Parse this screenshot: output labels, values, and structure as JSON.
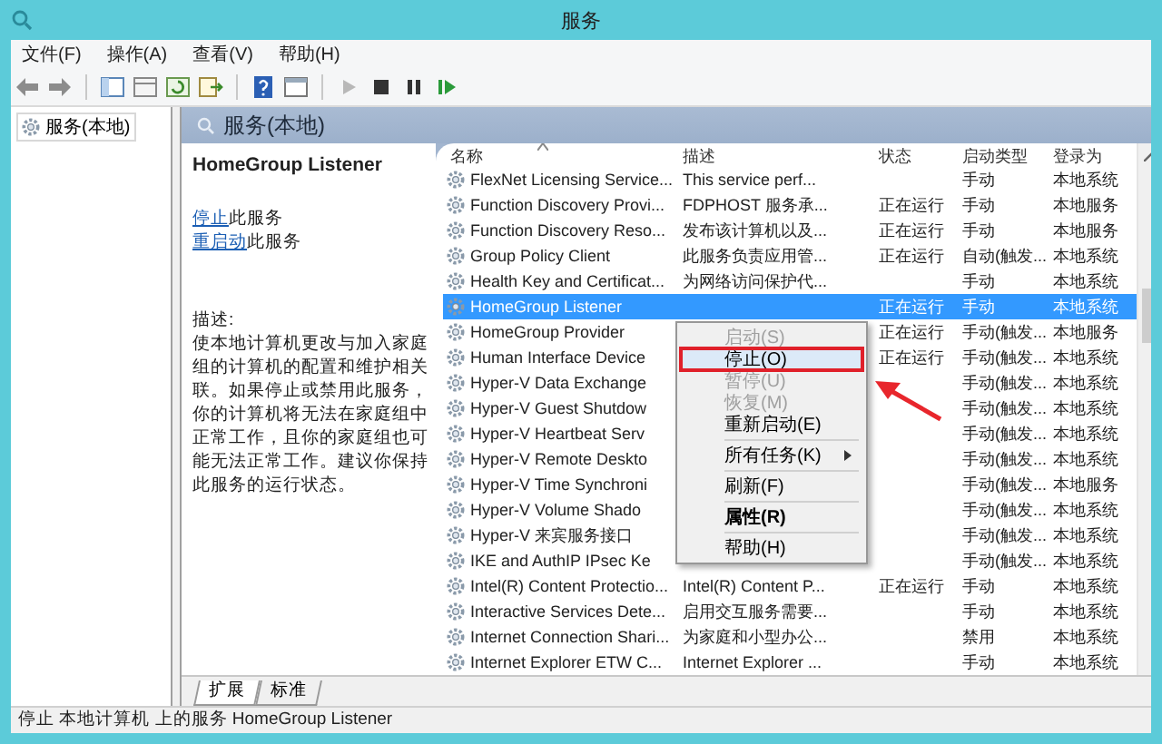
{
  "window": {
    "title": "服务"
  },
  "menu_bar": [
    "文件(F)",
    "操作(A)",
    "查看(V)",
    "帮助(H)"
  ],
  "tree": {
    "items": [
      {
        "label": "服务(本地)"
      }
    ]
  },
  "panel": {
    "title": "服务(本地)"
  },
  "details": {
    "service_name": "HomeGroup Listener",
    "actions": [
      {
        "link": "停止",
        "text": "此服务"
      },
      {
        "link": "重启动",
        "text": "此服务"
      }
    ],
    "description_label": "描述:",
    "description": "使本地计算机更改与加入家庭组的计算机的配置和维护相关联。如果停止或禁用此服务，你的计算机将无法在家庭组中正常工作，且你的家庭组也可能无法正常工作。建议你保持此服务的运行状态。"
  },
  "table": {
    "columns": [
      {
        "label": "名称",
        "sorted": true
      },
      {
        "label": "描述",
        "sorted": false
      },
      {
        "label": "状态",
        "sorted": false
      },
      {
        "label": "启动类型",
        "sorted": false
      },
      {
        "label": "登录为",
        "sorted": false
      }
    ],
    "rows": [
      {
        "name": "FlexNet Licensing Service...",
        "description": "This service perf...",
        "status": "",
        "startup": "手动",
        "logon": "本地系统",
        "selected": false
      },
      {
        "name": "Function Discovery Provi...",
        "description": "FDPHOST 服务承...",
        "status": "正在运行",
        "startup": "手动",
        "logon": "本地服务",
        "selected": false
      },
      {
        "name": "Function Discovery Reso...",
        "description": "发布该计算机以及...",
        "status": "正在运行",
        "startup": "手动",
        "logon": "本地服务",
        "selected": false
      },
      {
        "name": "Group Policy Client",
        "description": "此服务负责应用管...",
        "status": "正在运行",
        "startup": "自动(触发...",
        "logon": "本地系统",
        "selected": false
      },
      {
        "name": "Health Key and Certificat...",
        "description": "为网络访问保护代...",
        "status": "",
        "startup": "手动",
        "logon": "本地系统",
        "selected": false
      },
      {
        "name": "HomeGroup Listener",
        "description": "",
        "status": "正在运行",
        "startup": "手动",
        "logon": "本地系统",
        "selected": true
      },
      {
        "name": "HomeGroup Provider",
        "description": "",
        "status": "正在运行",
        "startup": "手动(触发...",
        "logon": "本地服务",
        "selected": false
      },
      {
        "name": "Human Interface Device",
        "description": "",
        "status": "正在运行",
        "startup": "手动(触发...",
        "logon": "本地系统",
        "selected": false
      },
      {
        "name": "Hyper-V Data Exchange",
        "description": "",
        "status": "",
        "startup": "手动(触发...",
        "logon": "本地系统",
        "selected": false
      },
      {
        "name": "Hyper-V Guest Shutdow",
        "description": "",
        "status": "",
        "startup": "手动(触发...",
        "logon": "本地系统",
        "selected": false
      },
      {
        "name": "Hyper-V Heartbeat Serv",
        "description": "",
        "status": "",
        "startup": "手动(触发...",
        "logon": "本地系统",
        "selected": false
      },
      {
        "name": "Hyper-V Remote Deskto",
        "description": "",
        "status": "",
        "startup": "手动(触发...",
        "logon": "本地系统",
        "selected": false
      },
      {
        "name": "Hyper-V Time Synchroni",
        "description": "",
        "status": "",
        "startup": "手动(触发...",
        "logon": "本地服务",
        "selected": false
      },
      {
        "name": "Hyper-V Volume Shado",
        "description": "",
        "status": "",
        "startup": "手动(触发...",
        "logon": "本地系统",
        "selected": false
      },
      {
        "name": "Hyper-V 来宾服务接口",
        "description": "",
        "status": "",
        "startup": "手动(触发...",
        "logon": "本地系统",
        "selected": false
      },
      {
        "name": "IKE and AuthIP IPsec Ke",
        "description": "",
        "status": "",
        "startup": "手动(触发...",
        "logon": "本地系统",
        "selected": false
      },
      {
        "name": "Intel(R) Content Protectio...",
        "description": "Intel(R) Content P...",
        "status": "正在运行",
        "startup": "手动",
        "logon": "本地系统",
        "selected": false
      },
      {
        "name": "Interactive Services Dete...",
        "description": "启用交互服务需要...",
        "status": "",
        "startup": "手动",
        "logon": "本地系统",
        "selected": false
      },
      {
        "name": "Internet Connection Shari...",
        "description": "为家庭和小型办公...",
        "status": "",
        "startup": "禁用",
        "logon": "本地系统",
        "selected": false
      },
      {
        "name": "Internet Explorer ETW C...",
        "description": "Internet Explorer ...",
        "status": "",
        "startup": "手动",
        "logon": "本地系统",
        "selected": false
      }
    ]
  },
  "context_menu": {
    "items": [
      {
        "kind": "item",
        "label": "启动(S)",
        "disabled": true,
        "selected": false,
        "default": false
      },
      {
        "kind": "item",
        "label": "停止(O)",
        "disabled": false,
        "selected": true,
        "default": false
      },
      {
        "kind": "item",
        "label": "暂停(U)",
        "disabled": true,
        "selected": false,
        "default": false
      },
      {
        "kind": "item",
        "label": "恢复(M)",
        "disabled": true,
        "selected": false,
        "default": false
      },
      {
        "kind": "item",
        "label": "重新启动(E)",
        "disabled": false,
        "selected": false,
        "default": false
      },
      {
        "kind": "separator"
      },
      {
        "kind": "submenu",
        "label": "所有任务(K)",
        "disabled": false,
        "selected": false,
        "default": false
      },
      {
        "kind": "separator"
      },
      {
        "kind": "item",
        "label": "刷新(F)",
        "disabled": false,
        "selected": false,
        "default": false
      },
      {
        "kind": "separator"
      },
      {
        "kind": "item",
        "label": "属性(R)",
        "disabled": false,
        "selected": false,
        "default": true
      },
      {
        "kind": "separator"
      },
      {
        "kind": "item",
        "label": "帮助(H)",
        "disabled": false,
        "selected": false,
        "default": false
      }
    ]
  },
  "tabs": [
    {
      "label": "扩展",
      "selected": true
    },
    {
      "label": "标准",
      "selected": false
    }
  ],
  "status_bar": "停止 本地计算机 上的服务 HomeGroup Listener"
}
